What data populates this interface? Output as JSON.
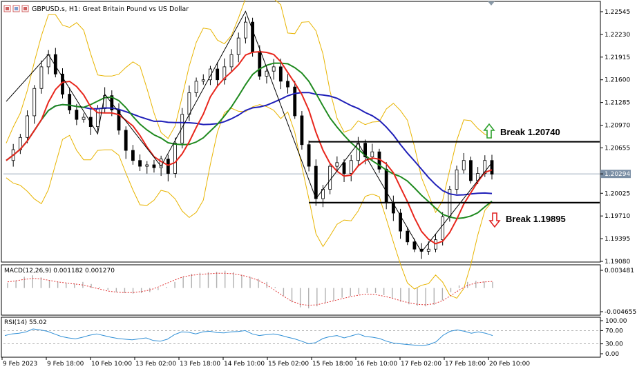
{
  "window": {
    "symbol_title": "GBPUSD.s, H1:  Great Britain Pound vs US Dollar"
  },
  "colors": {
    "candle": "#000000",
    "bollinger": "#e8b400",
    "ma_fast": "#e8261c",
    "ma_mid": "#1f8a1f",
    "ma_slow": "#1f1fb8",
    "macd_hist": "#b0b0b0",
    "macd_signal": "#e03030",
    "rsi": "#2f8fd6",
    "break_up": "#2ca02c",
    "break_down": "#e02020"
  },
  "chart_data": [
    {
      "type": "candlestick",
      "panel": "price",
      "yticks": [
        "1.22545",
        "1.22230",
        "1.21915",
        "1.21600",
        "1.21285",
        "1.20970",
        "1.20655",
        "1.20294",
        "1.20025",
        "1.19710",
        "1.19395",
        "1.19080"
      ],
      "ylim": [
        1.1908,
        1.2265
      ],
      "current_price": "1.20294",
      "xticks": [
        "9 Feb 2023",
        "9 Feb 18:00",
        "10 Feb 10:00",
        "13 Feb 02:00",
        "13 Feb 18:00",
        "14 Feb 10:00",
        "15 Feb 02:00",
        "15 Feb 18:00",
        "16 Feb 10:00",
        "17 Feb 02:00",
        "17 Feb 18:00",
        "20 Feb 10:00"
      ],
      "close_path": [
        1.2048,
        1.2063,
        1.208,
        1.211,
        1.2148,
        1.2178,
        1.2195,
        1.2168,
        1.214,
        1.2118,
        1.2105,
        1.2108,
        1.2095,
        1.212,
        1.2138,
        1.2118,
        1.209,
        1.2062,
        1.2048,
        1.204,
        1.2042,
        1.2038,
        1.205,
        1.203,
        1.2072,
        1.2112,
        1.2142,
        1.2158,
        1.216,
        1.2175,
        1.216,
        1.2178,
        1.2195,
        1.2218,
        1.224,
        1.2198,
        1.2165,
        1.2172,
        1.2178,
        1.2158,
        1.215,
        1.211,
        1.207,
        1.204,
        1.1995,
        1.2008,
        1.204,
        1.2045,
        1.203,
        1.2048,
        1.2072,
        1.2053,
        1.206,
        1.2036,
        1.199,
        1.1975,
        1.195,
        1.1935,
        1.1925,
        1.1922,
        1.1925,
        1.1938,
        1.197,
        1.2008,
        1.2035,
        1.2048,
        1.202,
        1.203,
        1.2048,
        1.2029
      ],
      "zigzag": [
        1.213,
        1.2195,
        1.2085,
        1.214,
        1.204,
        1.2255,
        1.1995,
        1.2072,
        1.1921,
        1.2045
      ],
      "annotations": [
        "Break 1.20740",
        "Break 1.19895"
      ],
      "levels": [
        1.2074,
        1.19895
      ]
    },
    {
      "type": "histogram",
      "panel": "macd",
      "label": "MACD(12,26,9) 0.001182 0.001270",
      "yticks": [
        "0.003481",
        "-0.004655"
      ],
      "ylim": [
        -0.004655,
        0.003481
      ],
      "values": [
        0.001,
        0.0015,
        0.0022,
        0.0025,
        0.0021,
        0.0015,
        0.0012,
        0.001,
        0.0009,
        0.0012,
        0.0008,
        0.0002,
        -0.0004,
        -0.0008,
        -0.001,
        -0.0011,
        -0.001,
        -0.0008,
        -0.0004,
        0.0002,
        0.0012,
        0.0022,
        0.0028,
        0.003,
        0.0031,
        0.0032,
        0.0034,
        0.0031,
        0.0026,
        0.0022,
        0.0018,
        0.0012,
        0.0002,
        -0.0015,
        -0.0028,
        -0.0038,
        -0.004,
        -0.0036,
        -0.003,
        -0.0024,
        -0.0019,
        -0.0016,
        -0.0012,
        -0.001,
        -0.001,
        -0.0014,
        -0.002,
        -0.0027,
        -0.0032,
        -0.0035,
        -0.0036,
        -0.0033,
        -0.0024,
        -0.0008,
        0.0005,
        0.0012,
        0.0014,
        0.0013,
        0.0012
      ],
      "signal": [
        0.0012,
        0.0014,
        0.0017,
        0.0019,
        0.0018,
        0.0015,
        0.0012,
        0.001,
        0.0008,
        0.0006,
        0.0002,
        -0.0002,
        -0.0006,
        -0.0008,
        -0.0009,
        -0.0009,
        -0.0007,
        -0.0004,
        0.0002,
        0.0009,
        0.0016,
        0.0022,
        0.0025,
        0.0027,
        0.0028,
        0.0029,
        0.0029,
        0.0028,
        0.0025,
        0.0021,
        0.0015,
        0.0006,
        -0.0005,
        -0.0016,
        -0.0026,
        -0.0032,
        -0.0034,
        -0.0033,
        -0.0029,
        -0.0025,
        -0.0021,
        -0.0017,
        -0.0014,
        -0.0012,
        -0.0013,
        -0.0016,
        -0.002,
        -0.0025,
        -0.0029,
        -0.0032,
        -0.0033,
        -0.0031,
        -0.0025,
        -0.0015,
        -0.0004,
        0.0005,
        0.001,
        0.0012,
        0.0013
      ]
    },
    {
      "type": "line",
      "panel": "rsi",
      "label": "RSI(14) 55.02",
      "yticks": [
        "100.00",
        "70.00",
        "30.00",
        "0.00"
      ],
      "ylim": [
        0,
        100
      ],
      "levels": [
        70,
        30
      ],
      "values": [
        55,
        60,
        62,
        66,
        75,
        72,
        68,
        60,
        52,
        48,
        45,
        50,
        56,
        60,
        55,
        50,
        46,
        44,
        42,
        45,
        48,
        40,
        38,
        44,
        58,
        66,
        65,
        60,
        66,
        68,
        64,
        63,
        66,
        67,
        70,
        60,
        55,
        58,
        60,
        56,
        50,
        45,
        38,
        30,
        34,
        46,
        52,
        55,
        48,
        54,
        60,
        52,
        50,
        46,
        38,
        32,
        30,
        28,
        26,
        24,
        28,
        36,
        56,
        68,
        72,
        68,
        62,
        66,
        62,
        55
      ]
    }
  ]
}
